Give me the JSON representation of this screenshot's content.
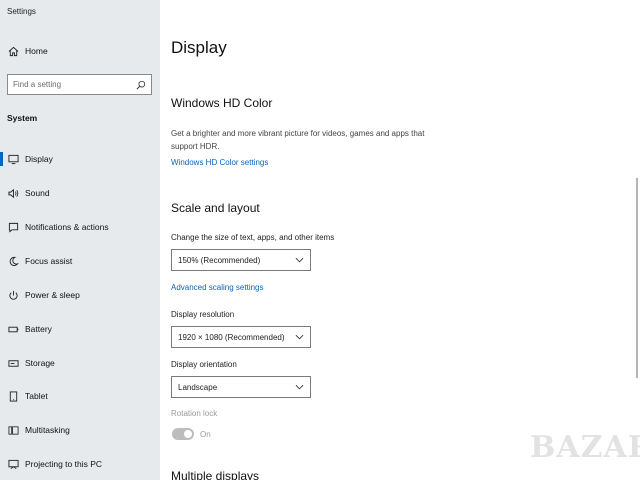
{
  "window": {
    "title": "Settings",
    "minimize": "—",
    "maximize": "❐",
    "close": "✕"
  },
  "sidebar": {
    "home": "Home",
    "search_placeholder": "Find a setting",
    "section": "System",
    "items": [
      {
        "label": "Display",
        "icon": "monitor-icon"
      },
      {
        "label": "Sound",
        "icon": "speaker-icon"
      },
      {
        "label": "Notifications & actions",
        "icon": "notification-icon"
      },
      {
        "label": "Focus assist",
        "icon": "moon-icon"
      },
      {
        "label": "Power & sleep",
        "icon": "power-icon"
      },
      {
        "label": "Battery",
        "icon": "battery-icon"
      },
      {
        "label": "Storage",
        "icon": "storage-icon"
      },
      {
        "label": "Tablet",
        "icon": "tablet-icon"
      },
      {
        "label": "Multitasking",
        "icon": "multitasking-icon"
      },
      {
        "label": "Projecting to this PC",
        "icon": "projecting-icon"
      }
    ],
    "active_index": 0
  },
  "main": {
    "title": "Display",
    "hdr": {
      "heading": "Windows HD Color",
      "description_line1": "Get a brighter and more vibrant picture for videos, games and apps that",
      "description_line2": "support HDR.",
      "link": "Windows HD Color settings"
    },
    "scale": {
      "heading": "Scale and layout",
      "size_label": "Change the size of text, apps, and other items",
      "size_value": "150% (Recommended)",
      "advanced_link": "Advanced scaling settings",
      "resolution_label": "Display resolution",
      "resolution_value": "1920 × 1080 (Recommended)",
      "orientation_label": "Display orientation",
      "orientation_value": "Landscape",
      "rotation_label": "Rotation lock",
      "rotation_state": "On"
    },
    "multiple_heading": "Multiple displays"
  },
  "watermark": "BAZAR",
  "colors": {
    "accent": "#0067c0",
    "link": "#0a64b8",
    "sidebar_bg": "#e6eaed"
  }
}
